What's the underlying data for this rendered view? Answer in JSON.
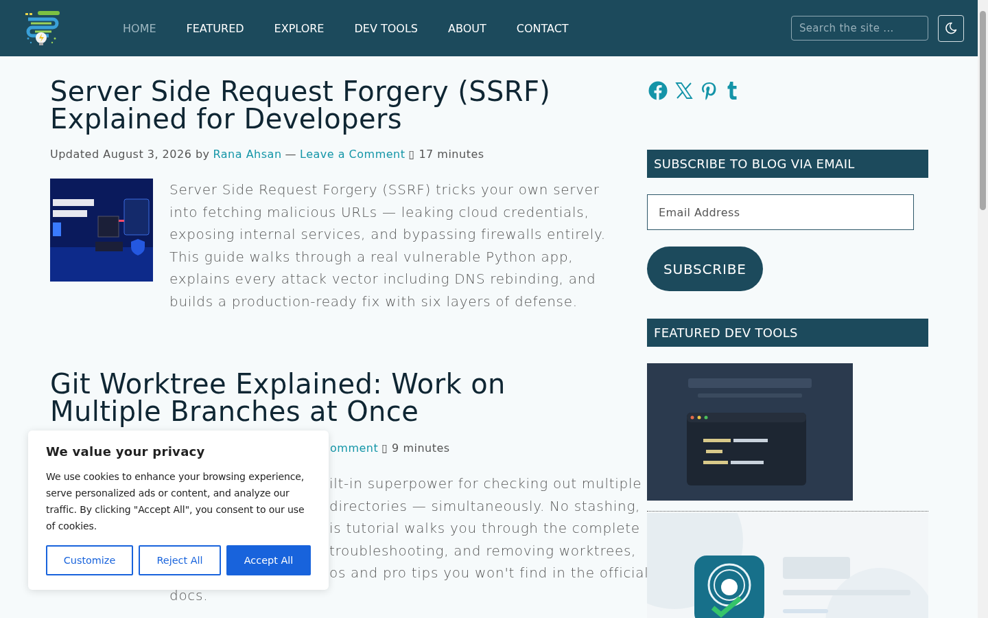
{
  "header": {
    "nav": [
      {
        "label": "HOME",
        "selected": true
      },
      {
        "label": "FEATURED",
        "selected": false
      },
      {
        "label": "EXPLORE",
        "selected": false
      },
      {
        "label": "DEV TOOLS",
        "selected": false
      },
      {
        "label": "ABOUT",
        "selected": false
      },
      {
        "label": "CONTACT",
        "selected": false
      }
    ],
    "search": {
      "placeholder": "Search the site ..."
    }
  },
  "posts": [
    {
      "title": "Server Side Request Forgery (SSRF) Explained for Developers",
      "meta": {
        "covered": false,
        "prefix": "Updated August 3, 2026 by",
        "author": "Rana Ahsan",
        "separator": "—",
        "comment_link": "Leave a Comment",
        "reading_time": "▯ 17 minutes"
      },
      "excerpt": "Server Side Request Forgery (SSRF) tricks your own server into fetching malicious URLs — leaking cloud credentials, exposing internal services, and bypassing firewalls entirely. This guide walks through a real vulnerable Python app, explains every attack vector including DNS rebinding, and builds a production-ready fix with six layers of defense."
    },
    {
      "title": "Git Worktree Explained: Work on Multiple Branches at Once",
      "meta": {
        "covered": true,
        "comment_link": "omment",
        "reading_time": "▯ 9 minutes"
      },
      "excerpt_lines": [
        {
          "text": "ilt-in superpower for checking out multiple",
          "covered": true
        },
        {
          "text": "directories — simultaneously. No stashing,",
          "covered": true
        },
        {
          "text": "is tutorial walks you through the complete",
          "covered": true
        },
        {
          "text": "troubleshooting, and removing worktrees,",
          "covered": true
        },
        {
          "text": "os and pro tips you won't find in the official",
          "covered": true
        },
        {
          "text": "docs.",
          "covered": false
        }
      ]
    }
  ],
  "sidebar": {
    "social": [
      {
        "kind": "facebook"
      },
      {
        "kind": "x"
      },
      {
        "kind": "pinterest"
      },
      {
        "kind": "tumblr"
      }
    ],
    "widgets": [
      {
        "kind": "subscribe",
        "title": "SUBSCRIBE TO BLOG VIA EMAIL",
        "email_placeholder": "Email Address",
        "button": "SUBSCRIBE"
      },
      {
        "kind": "tools",
        "title": "FEATURED DEV TOOLS"
      }
    ]
  },
  "cookie_notice": {
    "title": "We value your privacy",
    "text": "We use cookies to enhance your browsing experience, serve personalized ads or content, and analyze our traffic. By clicking \"Accept All\", you consent to our use of cookies.",
    "buttons": [
      {
        "label": "Customize",
        "kind": "outline"
      },
      {
        "label": "Reject All",
        "kind": "outline"
      },
      {
        "label": "Accept All",
        "kind": "primary"
      }
    ]
  }
}
